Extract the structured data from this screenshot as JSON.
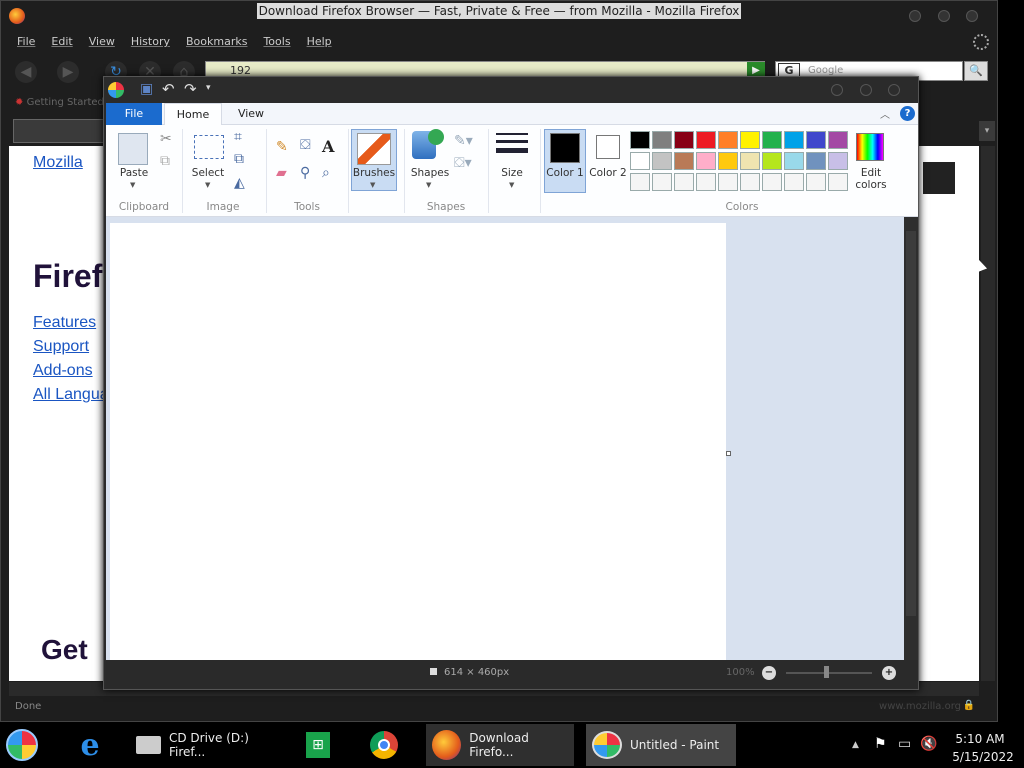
{
  "firefox": {
    "title": "Download Firefox Browser — Fast, Private & Free — from Mozilla - Mozilla Firefox",
    "menu": [
      "File",
      "Edit",
      "View",
      "History",
      "Bookmarks",
      "Tools",
      "Help"
    ],
    "url": "192",
    "search_placeholder": "Google",
    "search_engine_letter": "G",
    "bookmark": "Getting Started",
    "page": {
      "mozilla_link": "Mozilla",
      "heading": "Firef",
      "links": [
        "Features",
        "Support",
        "Add-ons",
        "All Langua"
      ],
      "bottom_heading": "Get"
    },
    "status": "Done",
    "status_right": "www.mozilla.org"
  },
  "paint": {
    "tabs": {
      "file": "File",
      "home": "Home",
      "view": "View"
    },
    "groups": {
      "clipboard": "Clipboard",
      "image": "Image",
      "tools": "Tools",
      "shapes": "Shapes",
      "colors": "Colors"
    },
    "buttons": {
      "paste": "Paste",
      "select": "Select",
      "brushes": "Brushes",
      "shapes": "Shapes",
      "size": "Size",
      "color1": "Color 1",
      "color2": "Color 2",
      "edit_colors": "Edit colors"
    },
    "palette_row1": [
      "#000000",
      "#7f7f7f",
      "#880015",
      "#ed1c24",
      "#ff7f27",
      "#fff200",
      "#22b14c",
      "#00a2e8",
      "#3f48cc",
      "#a349a4"
    ],
    "palette_row2": [
      "#ffffff",
      "#c3c3c3",
      "#b97a57",
      "#ffaec9",
      "#ffc90e",
      "#efe4b0",
      "#b5e61d",
      "#99d9ea",
      "#7092be",
      "#c8bfe7"
    ],
    "palette_row3": [
      "#f5f5f5",
      "#f5f5f5",
      "#f5f5f5",
      "#f5f5f5",
      "#f5f5f5",
      "#f5f5f5",
      "#f5f5f5",
      "#f5f5f5",
      "#f5f5f5",
      "#f5f5f5"
    ],
    "color1": "#000000",
    "color2": "#ffffff",
    "canvas_size": "614 × 460px",
    "zoom": "100%"
  },
  "taskbar": {
    "items": [
      "CD Drive (D:) Firef...",
      "Download Firefo...",
      "Untitled - Paint"
    ],
    "time": "5:10 AM",
    "date": "5/15/2022"
  }
}
